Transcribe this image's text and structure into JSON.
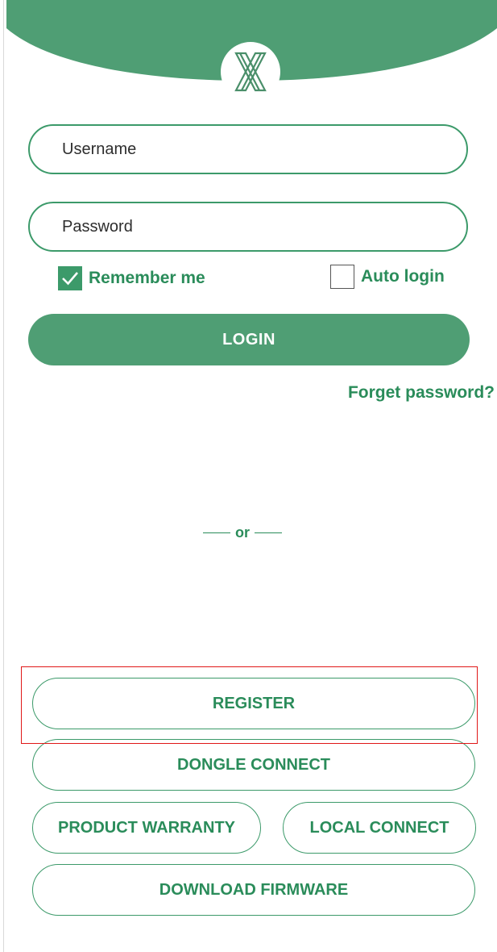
{
  "login": {
    "username_placeholder": "Username",
    "password_placeholder": "Password",
    "remember_me_label": "Remember me",
    "remember_me_checked": true,
    "auto_login_label": "Auto login",
    "auto_login_checked": false,
    "login_button_label": "LOGIN",
    "forgot_password_label": "Forget password?"
  },
  "divider": {
    "or_label": "or"
  },
  "actions": {
    "register_label": "REGISTER",
    "dongle_connect_label": "DONGLE CONNECT",
    "product_warranty_label": "PRODUCT WARRANTY",
    "local_connect_label": "LOCAL CONNECT",
    "download_firmware_label": "DOWNLOAD FIRMWARE"
  },
  "icons": {
    "logo": "x-logo-icon",
    "checkbox_checked": "checkmark-icon"
  },
  "colors": {
    "brand_green": "#4f9e74",
    "text_green": "#2a8c5a",
    "highlight_red": "#e01818"
  }
}
